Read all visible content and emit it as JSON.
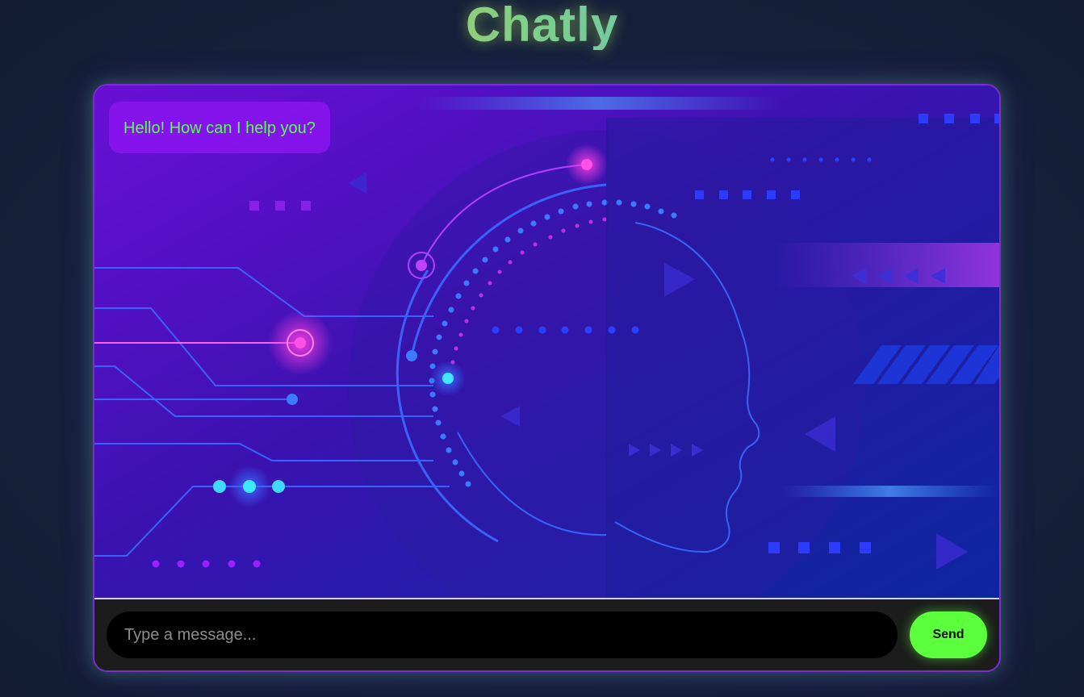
{
  "app": {
    "title": "Chatly"
  },
  "messages": [
    {
      "sender": "bot",
      "text": "Hello! How can I help you?"
    }
  ],
  "composer": {
    "placeholder": "Type a message...",
    "value": "",
    "send_label": "Send"
  },
  "colors": {
    "page_background": "#16203a",
    "bubble_background": "#8c14f0",
    "bubble_text": "#59ff4a",
    "send_button": "#5cff3c",
    "input_background": "#000000",
    "window_border": "#7b2bd8"
  }
}
